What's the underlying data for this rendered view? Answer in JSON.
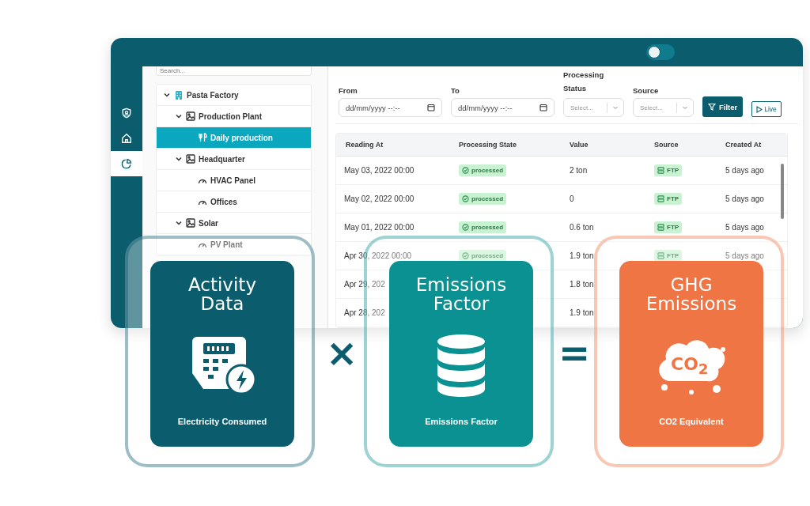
{
  "top_bar": {
    "toggle": {
      "on": false
    }
  },
  "rail": [
    {
      "kind": "shield",
      "selected": false
    },
    {
      "kind": "home",
      "selected": false
    },
    {
      "kind": "chart",
      "selected": true
    }
  ],
  "tree": {
    "search": {
      "placeholder": "Search..."
    },
    "items": [
      {
        "label": "Pasta Factory",
        "kind": "site",
        "expanded": true,
        "selected": false,
        "children": [
          {
            "label": "Production Plant",
            "kind": "area",
            "expanded": true,
            "selected": false,
            "children": [
              {
                "label": "Daily production",
                "kind": "production",
                "selected": true
              }
            ]
          },
          {
            "label": "Headquarter",
            "kind": "area",
            "expanded": true,
            "selected": false,
            "children": [
              {
                "label": "HVAC Panel",
                "kind": "meter",
                "selected": false
              },
              {
                "label": "Offices",
                "kind": "meter",
                "selected": false
              }
            ]
          },
          {
            "label": "Solar",
            "kind": "area",
            "expanded": true,
            "selected": false,
            "children": [
              {
                "label": "PV Plant",
                "kind": "meter",
                "selected": false
              }
            ]
          }
        ]
      }
    ]
  },
  "filters": {
    "from": {
      "label": "From",
      "placeholder": "dd/mm/yyyy --:--"
    },
    "to": {
      "label": "To",
      "placeholder": "dd/mm/yyyy --:--"
    },
    "status": {
      "label": "Processing Status",
      "placeholder": "Select..."
    },
    "source": {
      "label": "Source",
      "placeholder": "Select..."
    },
    "filter_button": "Filter",
    "live_button": "Live"
  },
  "table": {
    "columns": [
      "Reading At",
      "Processing State",
      "Value",
      "Source",
      "Created At"
    ],
    "rows": [
      {
        "reading_at": "May 03, 2022 00:00",
        "state": "processed",
        "value": "2 ton",
        "source": "FTP",
        "created_at": "5 days ago"
      },
      {
        "reading_at": "May 02, 2022 00:00",
        "state": "processed",
        "value": "0",
        "source": "FTP",
        "created_at": "5 days ago"
      },
      {
        "reading_at": "May 01, 2022 00:00",
        "state": "processed",
        "value": "0.6 ton",
        "source": "FTP",
        "created_at": "5 days ago"
      },
      {
        "reading_at": "Apr 30, 2022 00:00",
        "state": "processed",
        "value": "1.9 ton",
        "source": "FTP",
        "created_at": "5 days ago"
      },
      {
        "reading_at": "Apr 29, 202",
        "value": "1.8 ton"
      },
      {
        "reading_at": "Apr 28, 202",
        "value": "1.9 ton"
      }
    ]
  },
  "formula": {
    "cards": [
      {
        "title": "Activity Data",
        "subtitle": "Electricity Consumed",
        "kind": "meter",
        "color": "#0b5d6e"
      },
      {
        "title": "Emissions Factor",
        "subtitle": "Emissions Factor",
        "kind": "database",
        "color": "#0b9192"
      },
      {
        "title": "GHG Emissions",
        "subtitle": "CO2 Equivalent",
        "kind": "co2",
        "color": "#f07545",
        "icon_text": "CO$_{2}$"
      }
    ],
    "operators": [
      "×",
      "="
    ]
  }
}
